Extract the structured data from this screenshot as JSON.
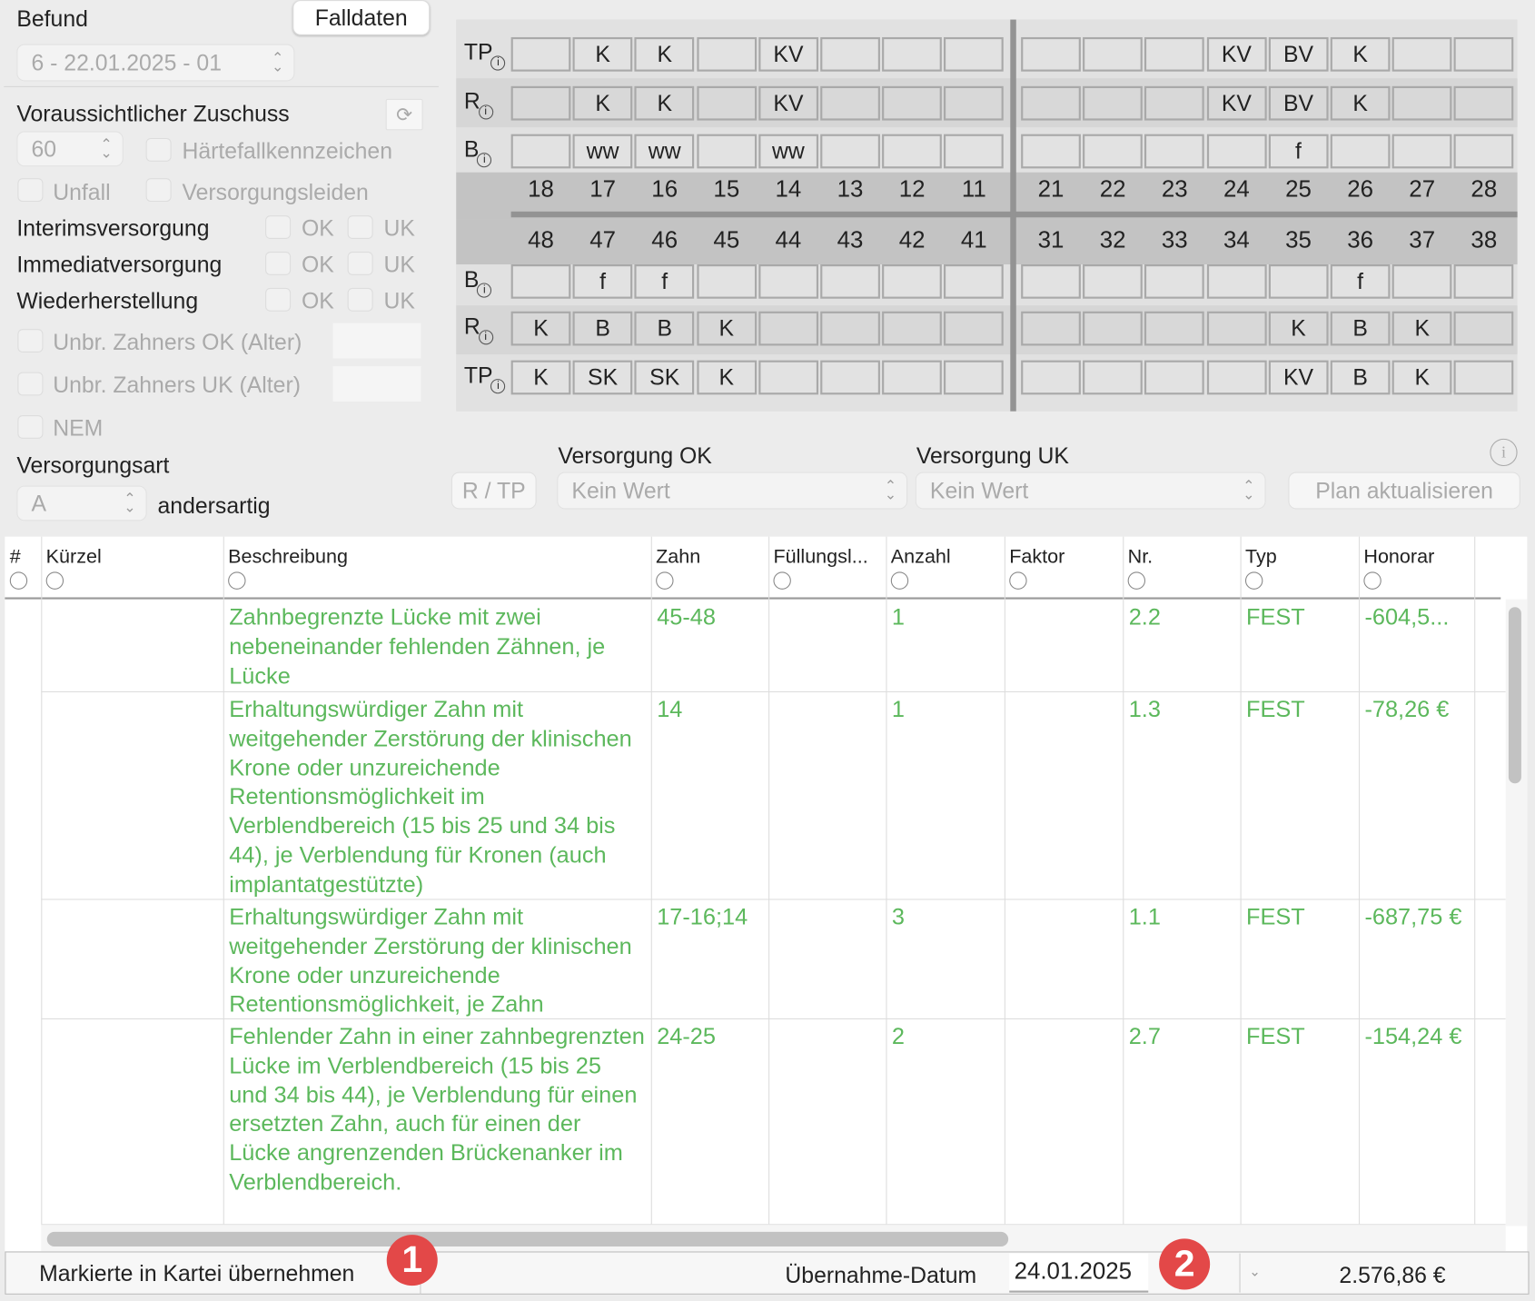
{
  "left": {
    "befund_label": "Befund",
    "falldaten_button": "Falldaten",
    "befund_select": "6 - 22.01.2025 - 01",
    "zuschuss_label": "Voraussichtlicher Zuschuss",
    "zuschuss_value": "60",
    "haertefall": "Härtefallkennzeichen",
    "unfall": "Unfall",
    "versorgungsleiden": "Versorgungsleiden",
    "interims": "Interimsversorgung",
    "immediat": "Immediatversorgung",
    "wiederherstellung": "Wiederherstellung",
    "ok": "OK",
    "uk": "UK",
    "unbr_ok": "Unbr. Zahners OK (Alter)",
    "unbr_uk": "Unbr. Zahners UK (Alter)",
    "nem": "NEM",
    "versorgungsart_label": "Versorgungsart",
    "versorgungsart_value": "A",
    "versorgungsart_text": "andersartig"
  },
  "chart": {
    "upper_left_teeth": [
      "18",
      "17",
      "16",
      "15",
      "14",
      "13",
      "12",
      "11"
    ],
    "upper_right_teeth": [
      "21",
      "22",
      "23",
      "24",
      "25",
      "26",
      "27",
      "28"
    ],
    "lower_left_teeth": [
      "48",
      "47",
      "46",
      "45",
      "44",
      "43",
      "42",
      "41"
    ],
    "lower_right_teeth": [
      "31",
      "32",
      "33",
      "34",
      "35",
      "36",
      "37",
      "38"
    ],
    "rows": [
      {
        "label": "TP",
        "cells": [
          "",
          "K",
          "K",
          "",
          "KV",
          "",
          "",
          "",
          "",
          "",
          "",
          "KV",
          "BV",
          "K",
          "",
          ""
        ]
      },
      {
        "label": "R",
        "cells": [
          "",
          "K",
          "K",
          "",
          "KV",
          "",
          "",
          "",
          "",
          "",
          "",
          "KV",
          "BV",
          "K",
          "",
          ""
        ]
      },
      {
        "label": "B",
        "cells": [
          "",
          "ww",
          "ww",
          "",
          "ww",
          "",
          "",
          "",
          "",
          "",
          "",
          "",
          "f",
          "",
          "",
          ""
        ]
      },
      {
        "label": "B",
        "cells": [
          "",
          "f",
          "f",
          "",
          "",
          "",
          "",
          "",
          "",
          "",
          "",
          "",
          "",
          "f",
          "",
          ""
        ]
      },
      {
        "label": "R",
        "cells": [
          "K",
          "B",
          "B",
          "K",
          "",
          "",
          "",
          "",
          "",
          "",
          "",
          "",
          "K",
          "B",
          "K",
          ""
        ]
      },
      {
        "label": "TP",
        "cells": [
          "K",
          "SK",
          "SK",
          "K",
          "",
          "",
          "",
          "",
          "",
          "",
          "",
          "",
          "KV",
          "B",
          "K",
          ""
        ]
      }
    ]
  },
  "controls": {
    "rtp_button": "R / TP",
    "versorgung_ok_label": "Versorgung OK",
    "versorgung_ok_value": "Kein Wert",
    "versorgung_uk_label": "Versorgung UK",
    "versorgung_uk_value": "Kein Wert",
    "plan_button": "Plan aktualisieren"
  },
  "table": {
    "columns": [
      "#",
      "Kürzel",
      "Beschreibung",
      "Zahn",
      "Füllungsl...",
      "Anzahl",
      "Faktor",
      "Nr.",
      "Typ",
      "Honorar"
    ],
    "rows": [
      {
        "beschreibung": "Zahnbegrenzte Lücke mit zwei nebeneinander fehlenden Zähnen, je Lücke",
        "zahn": "45-48",
        "anzahl": "1",
        "nr": "2.2",
        "typ": "FEST",
        "honorar": "-604,5..."
      },
      {
        "beschreibung": "Erhaltungswürdiger Zahn mit weitgehender Zerstörung der klinischen Krone oder unzureichende Retentionsmöglichkeit im Verblendbereich (15 bis 25 und 34 bis 44), je Verblendung für Kronen (auch implantatgestützte)",
        "zahn": "14",
        "anzahl": "1",
        "nr": "1.3",
        "typ": "FEST",
        "honorar": "-78,26 €"
      },
      {
        "beschreibung": "Erhaltungswürdiger Zahn mit weitgehender Zerstörung der klinischen Krone oder unzureichende Retentionsmöglichkeit, je Zahn",
        "zahn": "17-16;14",
        "anzahl": "3",
        "nr": "1.1",
        "typ": "FEST",
        "honorar": "-687,75 €"
      },
      {
        "beschreibung": "Fehlender Zahn in einer zahnbegrenzten Lücke im Verblendbereich (15 bis 25 und 34 bis 44), je Verblendung für einen ersetzten Zahn, auch für einen der Lücke angrenzenden Brückenanker im Verblendbereich.",
        "zahn": "24-25",
        "anzahl": "2",
        "nr": "2.7",
        "typ": "FEST",
        "honorar": "-154,24 €"
      }
    ]
  },
  "footer": {
    "uebernehmen_button": "Markierte in Kartei übernehmen",
    "datum_label": "Übernahme-Datum",
    "datum_value": "24.01.2025",
    "total": "2.576,86 €",
    "badge1": "1",
    "badge2": "2"
  },
  "colors": {
    "row_text": "#5cb85c",
    "badge": "#e34848"
  }
}
